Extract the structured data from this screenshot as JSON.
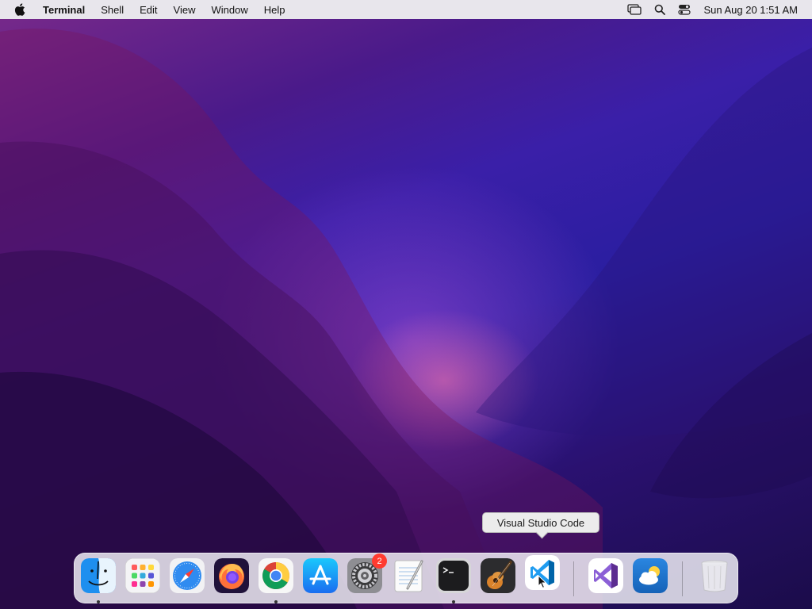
{
  "menubar": {
    "apple_icon": "apple-logo-icon",
    "app_name": "Terminal",
    "menus": [
      "Shell",
      "Edit",
      "View",
      "Window",
      "Help"
    ],
    "status_icons": [
      "screen-mirroring-icon",
      "spotlight-search-icon",
      "control-center-icon"
    ],
    "clock": "Sun Aug 20  1:51 AM"
  },
  "dock": {
    "items": [
      {
        "name": "Finder",
        "icon": "finder-icon",
        "running": true
      },
      {
        "name": "Launchpad",
        "icon": "launchpad-icon",
        "running": false
      },
      {
        "name": "Safari",
        "icon": "safari-icon",
        "running": false
      },
      {
        "name": "Firefox",
        "icon": "firefox-icon",
        "running": false
      },
      {
        "name": "Google Chrome",
        "icon": "chrome-icon",
        "running": true
      },
      {
        "name": "App Store",
        "icon": "app-store-icon",
        "running": false
      },
      {
        "name": "System Settings",
        "icon": "system-settings-icon",
        "running": false,
        "badge": "2"
      },
      {
        "name": "TextEdit",
        "icon": "textedit-icon",
        "running": false
      },
      {
        "name": "Terminal",
        "icon": "terminal-icon",
        "running": true
      },
      {
        "name": "GarageBand",
        "icon": "garageband-icon",
        "running": false
      },
      {
        "name": "Visual Studio Code",
        "icon": "vscode-icon",
        "running": false
      },
      {
        "name": "Visual Studio",
        "icon": "visual-studio-icon",
        "running": false
      },
      {
        "name": "Weather",
        "icon": "weather-icon",
        "running": false
      },
      {
        "name": "Trash",
        "icon": "trash-icon",
        "running": false
      }
    ],
    "system_settings_badge": "2"
  },
  "tooltip": {
    "text": "Visual Studio Code"
  },
  "colors": {
    "menubar": "#e8e6ec",
    "badge": "#ff3b30",
    "finder_blue": "#1e8fef",
    "vscode_blue": "#1f9cf0"
  }
}
